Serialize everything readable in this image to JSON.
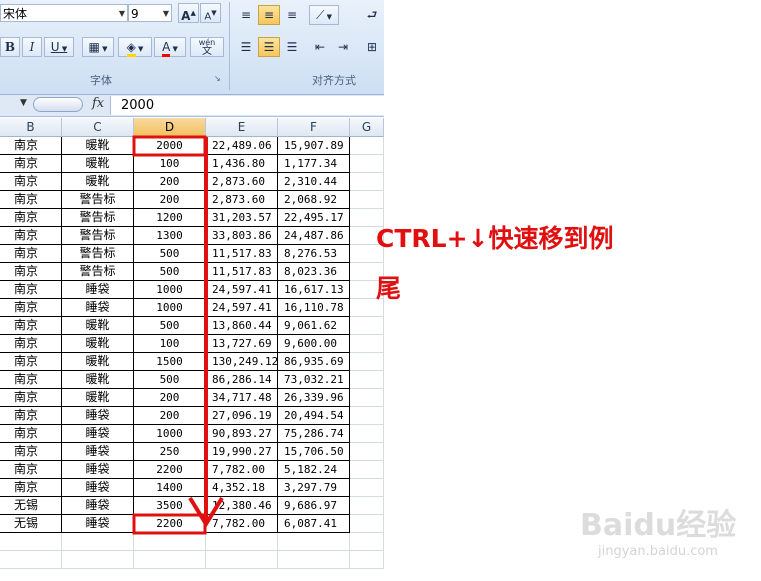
{
  "ribbon": {
    "font_name": "宋体",
    "font_size": "9",
    "bold_label": "B",
    "italic_label": "I",
    "underline_label": "U",
    "font_color_label": "A",
    "phonetic_label": "wén",
    "grow_label": "A",
    "shrink_label": "A",
    "group_font": "字体",
    "group_align": "对齐方式"
  },
  "formula_bar": {
    "fx_label": "fx",
    "value": "2000"
  },
  "sheet": {
    "columns": [
      "B",
      "C",
      "D",
      "E",
      "F",
      "G"
    ],
    "selected_column": "D",
    "rows": [
      [
        "南京",
        "暖靴",
        "2000",
        "22,489.06",
        "15,907.89"
      ],
      [
        "南京",
        "暖靴",
        "100",
        "1,436.80",
        "1,177.34"
      ],
      [
        "南京",
        "暖靴",
        "200",
        "2,873.60",
        "2,310.44"
      ],
      [
        "南京",
        "警告标",
        "200",
        "2,873.60",
        "2,068.92"
      ],
      [
        "南京",
        "警告标",
        "1200",
        "31,203.57",
        "22,495.17"
      ],
      [
        "南京",
        "警告标",
        "1300",
        "33,803.86",
        "24,487.86"
      ],
      [
        "南京",
        "警告标",
        "500",
        "11,517.83",
        "8,276.53"
      ],
      [
        "南京",
        "警告标",
        "500",
        "11,517.83",
        "8,023.36"
      ],
      [
        "南京",
        "睡袋",
        "1000",
        "24,597.41",
        "16,617.13"
      ],
      [
        "南京",
        "睡袋",
        "1000",
        "24,597.41",
        "16,110.78"
      ],
      [
        "南京",
        "暖靴",
        "500",
        "13,860.44",
        "9,061.62"
      ],
      [
        "南京",
        "暖靴",
        "100",
        "13,727.69",
        "9,600.00"
      ],
      [
        "南京",
        "暖靴",
        "1500",
        "130,249.12",
        "86,935.69"
      ],
      [
        "南京",
        "暖靴",
        "500",
        "86,286.14",
        "73,032.21"
      ],
      [
        "南京",
        "暖靴",
        "200",
        "34,717.48",
        "26,339.96"
      ],
      [
        "南京",
        "睡袋",
        "200",
        "27,096.19",
        "20,494.54"
      ],
      [
        "南京",
        "睡袋",
        "1000",
        "90,893.27",
        "75,286.74"
      ],
      [
        "南京",
        "睡袋",
        "250",
        "19,990.27",
        "15,706.50"
      ],
      [
        "南京",
        "睡袋",
        "2200",
        "7,782.00",
        "5,182.24"
      ],
      [
        "南京",
        "睡袋",
        "1400",
        "4,352.18",
        "3,297.79"
      ],
      [
        "无锡",
        "睡袋",
        "3500",
        "12,380.46",
        "9,686.97"
      ],
      [
        "无锡",
        "睡袋",
        "2200",
        "7,782.00",
        "6,087.41"
      ]
    ]
  },
  "annotation": {
    "line1": "CTRL+↓快速移到例",
    "line2": "尾",
    "color": "#e01010"
  },
  "watermark": {
    "brand": "Baidu经验",
    "url": "jingyan.baidu.com"
  }
}
